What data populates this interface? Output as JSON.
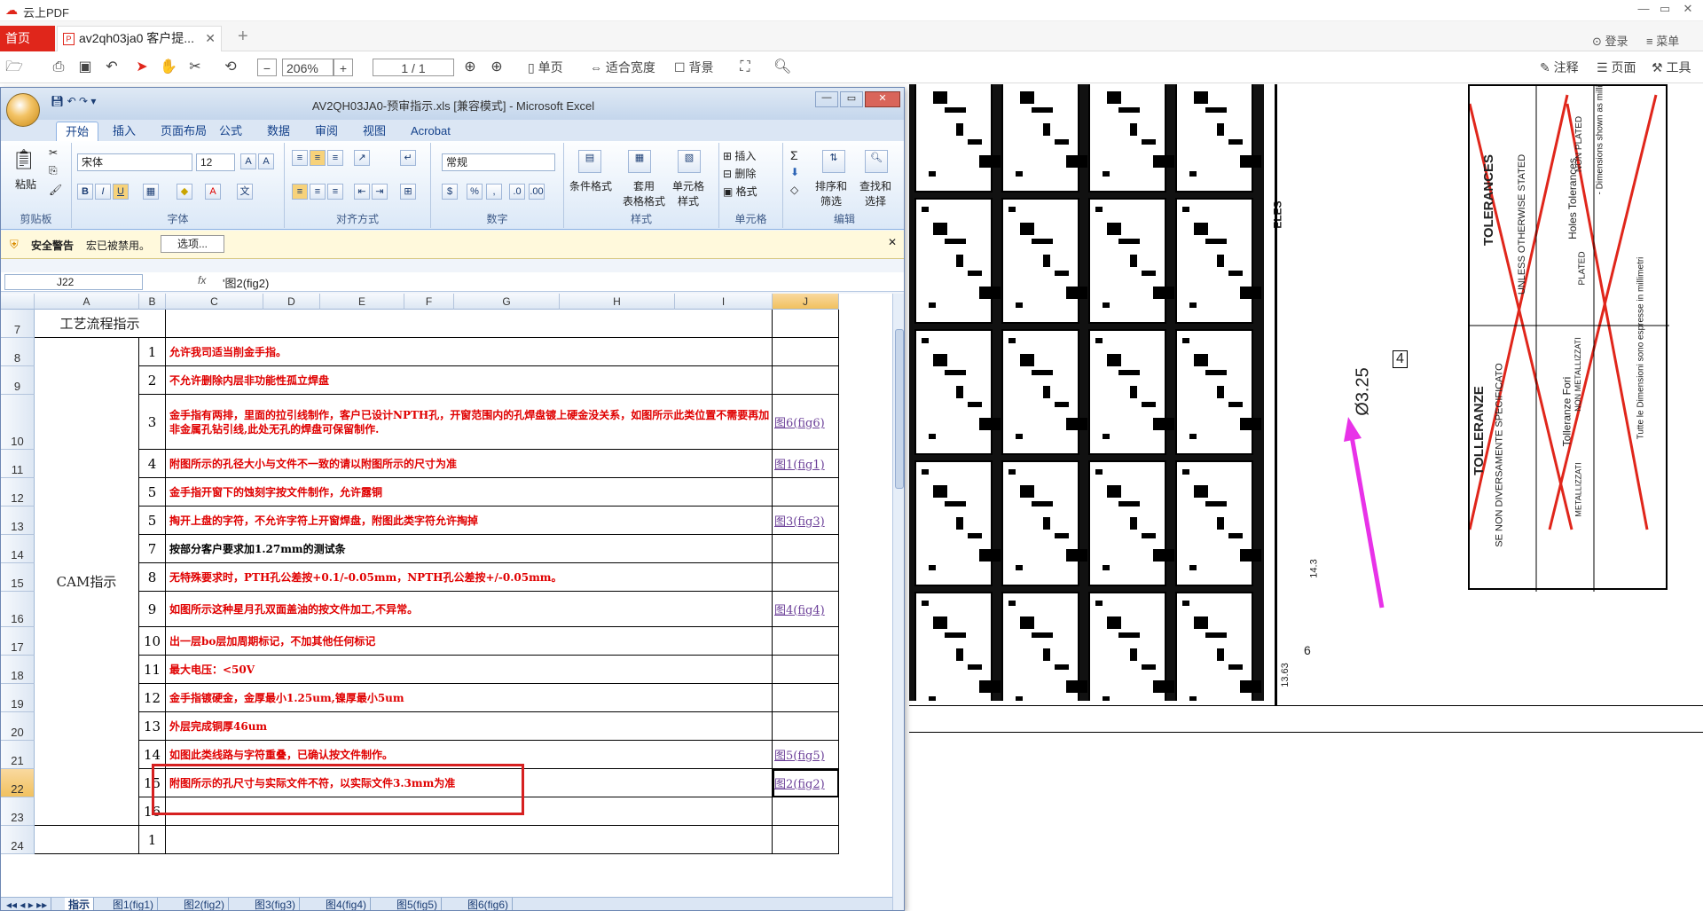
{
  "app": {
    "title": "云上PDF",
    "minimize": "—",
    "restore": "▭",
    "close": "✕"
  },
  "tabs": {
    "home": "首页",
    "doc": "av2qh03ja0 客户提...",
    "doc_close": "✕",
    "new_tab": "+"
  },
  "toolbar": {
    "zoom": "206%",
    "page_current": "1",
    "page_total": "/ 1",
    "single_page": "单页",
    "fit_width": "适合宽度",
    "background": "背景",
    "annotate": "注释",
    "page": "页面",
    "tools": "工具",
    "login": "登录",
    "menu": "菜单"
  },
  "excel": {
    "caption": "AV2QH03JA0-预审指示.xls [兼容模式] - Microsoft Excel",
    "ribbon_tabs": [
      "开始",
      "插入",
      "页面布局",
      "公式",
      "数据",
      "审阅",
      "视图",
      "Acrobat"
    ],
    "groups": {
      "clipboard": "剪贴板",
      "font": "字体",
      "align": "对齐方式",
      "number": "数字",
      "styles": "样式",
      "cells": "单元格",
      "edit": "编辑"
    },
    "paste": "粘贴",
    "font_name": "宋体",
    "font_size": "12",
    "number_format": "常规",
    "cond_format": "条件格式",
    "table_format": "套用\n表格格式",
    "cell_style": "单元格\n样式",
    "insert": "插入",
    "delete": "删除",
    "format": "格式",
    "sort": "排序和\n筛选",
    "find": "查找和\n选择",
    "security_title": "安全警告",
    "security_msg": "宏已被禁用。",
    "options_btn": "选项...",
    "name_box": "J22",
    "formula_value": "'图2(fig2)",
    "columns": [
      "A",
      "B",
      "C",
      "D",
      "E",
      "F",
      "G",
      "H",
      "I",
      "J"
    ],
    "rows": [
      {
        "r": "7",
        "b": "",
        "text": "",
        "link": ""
      },
      {
        "r": "8",
        "b": "1",
        "text": "允许我司适当削金手指。",
        "link": ""
      },
      {
        "r": "9",
        "b": "2",
        "text": "不允许删除内层非功能性孤立焊盘",
        "link": ""
      },
      {
        "r": "10",
        "b": "3",
        "text": "金手指有两排，里面的拉引线制作，客户已设计NPTH孔，开窗范围内的孔焊盘镀上硬金没关系，如图所示此类位置不需要再加非金属孔钻引线,此处无孔的焊盘可保留制作.",
        "link": "图6(fig6)"
      },
      {
        "r": "11",
        "b": "4",
        "text": "附图所示的孔径大小与文件不一致的请以附图所示的尺寸为准",
        "link": "图1(fig1)"
      },
      {
        "r": "12",
        "b": "5",
        "text": "金手指开窗下的蚀刻字按文件制作，允许露铜",
        "link": ""
      },
      {
        "r": "13",
        "b": "5",
        "text": "掏开上盘的字符，不允许字符上开窗焊盘，附图此类字符允许掏掉",
        "link": "图3(fig3)"
      },
      {
        "r": "14",
        "b": "7",
        "text": "按部分客户要求加1.27mm的测试条",
        "link": ""
      },
      {
        "r": "15",
        "b": "8",
        "text": "无特殊要求时，PTH孔公差按+0.1/-0.05mm，NPTH孔公差按+/-0.05mm。",
        "link": ""
      },
      {
        "r": "16",
        "b": "9",
        "text": "如图所示这种星月孔双面盖油的按文件加工,不异常。",
        "link": "图4(fig4)"
      },
      {
        "r": "17",
        "b": "10",
        "text": "出一层bo层加周期标记，不加其他任何标记",
        "link": ""
      },
      {
        "r": "18",
        "b": "11",
        "text": "最大电压：<50V",
        "link": ""
      },
      {
        "r": "19",
        "b": "12",
        "text": "金手指镀硬金，金厚最小1.25um,镍厚最小5um",
        "link": ""
      },
      {
        "r": "20",
        "b": "13",
        "text": "外层完成铜厚46um",
        "link": ""
      },
      {
        "r": "21",
        "b": "14",
        "text": "如图此类线路与字符重叠，已确认按文件制作。",
        "link": "图5(fig5)"
      },
      {
        "r": "22",
        "b": "15",
        "text": "附图所示的孔尺寸与实际文件不符，以实际文件3.3mm为准",
        "link": "图2(fig2)"
      },
      {
        "r": "23",
        "b": "16",
        "text": "",
        "link": ""
      },
      {
        "r": "24",
        "b": "1",
        "text": "",
        "link": ""
      }
    ],
    "a7": "工艺流程指示",
    "a_merged": "CAM指示",
    "sheet_tabs": [
      "指示",
      "图1(fig1)",
      "图2(fig2)",
      "图3(fig3)",
      "图4(fig4)",
      "图5(fig5)",
      "图6(fig6)"
    ]
  },
  "drawing": {
    "label_eles": "ELES",
    "dim_hole": "Ø3.25",
    "dim_tri": "4",
    "dim_143": "14.3",
    "dim_6": "6",
    "dim_1363": "13.63",
    "tol_title_en": "TOLERANCES",
    "tol_sub_en": "UNLESS OTHERWISE STATED",
    "tol_title_it": "TOLLERANZE",
    "tol_sub_it": "SE NON DIVERSAMENTE SPECIFICATO",
    "holes_tol": "Holes Tolerances",
    "tolleranze_fori": "Tolleranze Fori",
    "plated": "PLATED",
    "non_plated": "NON PLATED",
    "metallizzati": "METALLIZZATI",
    "non_metallizzati": "NON METALLIZZATI",
    "dims_note": "- Dimensions shown as millimeters",
    "dims_note_it": "Tutte le Dimensioni sono espresse in millimetri"
  }
}
